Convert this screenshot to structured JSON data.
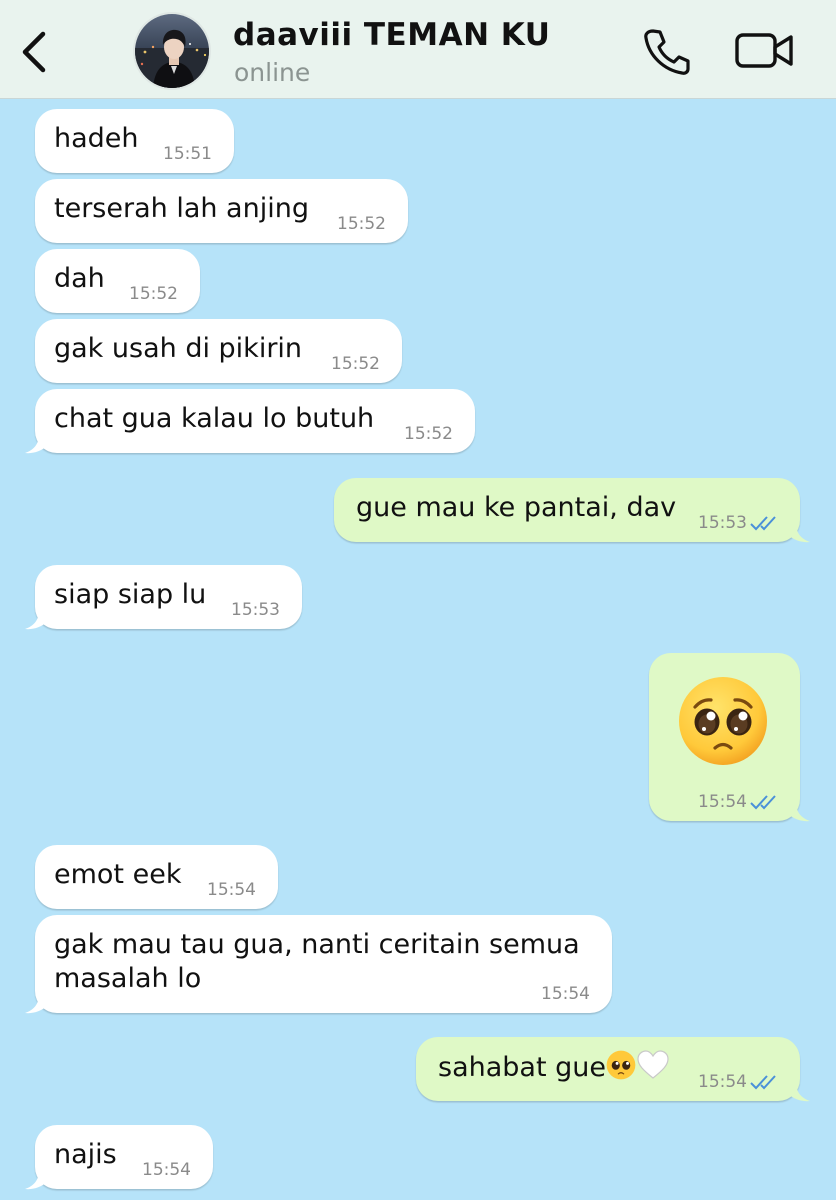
{
  "header": {
    "contact_name": "daaviii TEMAN KU",
    "status": "online",
    "back_icon": "chevron-left-icon",
    "call_icon": "phone-icon",
    "video_icon": "video-camera-icon"
  },
  "messages": [
    {
      "dir": "in",
      "text": "hadeh",
      "time": "15:51"
    },
    {
      "dir": "in",
      "text": "terserah lah anjing",
      "time": "15:52"
    },
    {
      "dir": "in",
      "text": "dah",
      "time": "15:52"
    },
    {
      "dir": "in",
      "text": "gak usah di pikirin",
      "time": "15:52"
    },
    {
      "dir": "in",
      "text": "chat gua kalau lo butuh",
      "time": "15:52"
    },
    {
      "dir": "out",
      "text": "gue mau ke pantai, dav",
      "time": "15:53",
      "read": true
    },
    {
      "dir": "in",
      "text": "siap siap lu",
      "time": "15:53"
    },
    {
      "dir": "out",
      "text": "🥺",
      "time": "15:54",
      "read": true
    },
    {
      "dir": "in",
      "text": "emot eek",
      "time": "15:54"
    },
    {
      "dir": "in",
      "line1": "gak mau tau gua, nanti ceritain semua",
      "line2": "masalah lo",
      "time": "15:54"
    },
    {
      "dir": "out",
      "text": "sahabat gue🥺🤍",
      "text_plain": "sahabat gue",
      "time": "15:54",
      "read": true
    },
    {
      "dir": "in",
      "text": "najis",
      "time": "15:54"
    }
  ],
  "colors": {
    "chat_background": "#b6e3f9",
    "header_background": "#e9f3ee",
    "incoming_bubble": "#ffffff",
    "outgoing_bubble": "#dff9c6",
    "read_ticks": "#4a90d9",
    "timestamp": "#8a8a8a"
  }
}
